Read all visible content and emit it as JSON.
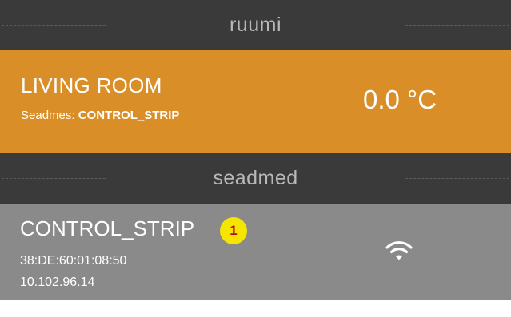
{
  "sections": {
    "rooms_title": "ruumi",
    "devices_title": "seadmed"
  },
  "room": {
    "name": "LIVING ROOM",
    "devices_label": "Seadmes:",
    "devices_value": "CONTROL_STRIP",
    "temperature": "0.0 °C"
  },
  "device": {
    "name": "CONTROL_STRIP",
    "mac": "38:DE:60:01:08:50",
    "ip": "10.102.96.14",
    "badge": "1",
    "status_icon": "wifi-icon"
  },
  "colors": {
    "header_bg": "#3a3a3a",
    "room_bg": "#d98e27",
    "device_bg": "#8a8a8a",
    "badge_bg": "#f5e500",
    "badge_text": "#c01010"
  }
}
